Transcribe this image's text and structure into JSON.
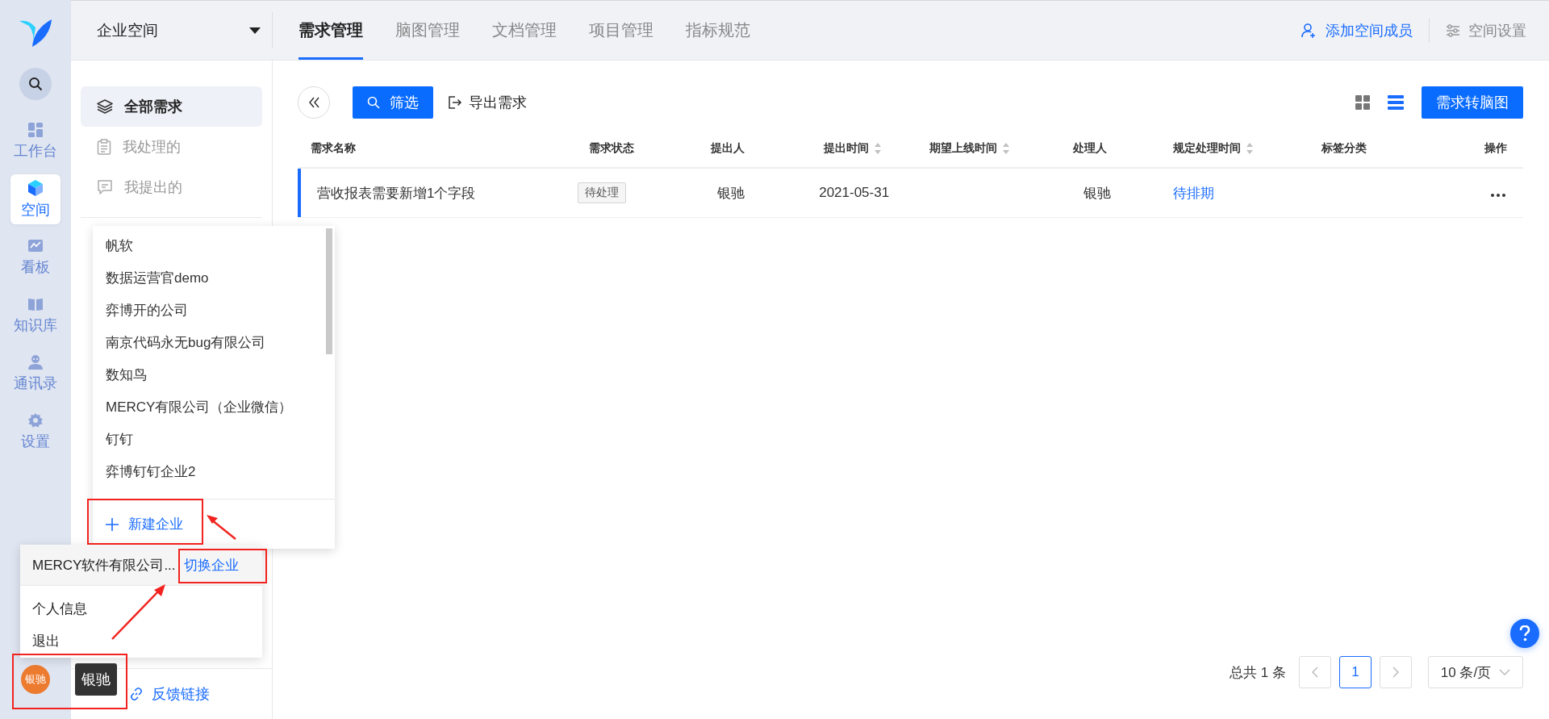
{
  "rail": {
    "items": [
      {
        "kind": "dashboard",
        "label": "工作台",
        "selected": false
      },
      {
        "kind": "cube",
        "label": "空间",
        "selected": true
      },
      {
        "kind": "board",
        "label": "看板",
        "selected": false
      },
      {
        "kind": "book",
        "label": "知识库",
        "selected": false
      },
      {
        "kind": "contacts",
        "label": "通讯录",
        "selected": false
      },
      {
        "kind": "settings",
        "label": "设置",
        "selected": false
      }
    ]
  },
  "space_selector": {
    "label": "企业空间"
  },
  "tabs": [
    {
      "label": "需求管理",
      "selected": true
    },
    {
      "label": "脑图管理",
      "selected": false
    },
    {
      "label": "文档管理",
      "selected": false
    },
    {
      "label": "项目管理",
      "selected": false
    },
    {
      "label": "指标规范",
      "selected": false
    }
  ],
  "header_actions": [
    {
      "kind": "add-member",
      "label": "添加空间成员"
    },
    {
      "kind": "settings",
      "label": "空间设置"
    }
  ],
  "nav": {
    "items": [
      {
        "kind": "layers",
        "label": "全部需求",
        "selected": true
      },
      {
        "kind": "clipboard",
        "label": "我处理的",
        "selected": false
      },
      {
        "kind": "comment",
        "label": "我提出的",
        "selected": false
      }
    ],
    "feedback_link": "反馈链接"
  },
  "toolbar": {
    "filter": "筛选",
    "export": "导出需求",
    "convert": "需求转脑图",
    "view_modes": [
      {
        "kind": "grid",
        "selected": false
      },
      {
        "kind": "list",
        "selected": true
      }
    ]
  },
  "table": {
    "columns": [
      {
        "label": "需求名称",
        "sortable": false
      },
      {
        "label": "需求状态",
        "sortable": false
      },
      {
        "label": "提出人",
        "sortable": false
      },
      {
        "label": "提出时间",
        "sortable": true
      },
      {
        "label": "期望上线时间",
        "sortable": true
      },
      {
        "label": "处理人",
        "sortable": false
      },
      {
        "label": "规定处理时间",
        "sortable": true
      },
      {
        "label": "标签分类",
        "sortable": false
      },
      {
        "label": "操作",
        "sortable": false
      }
    ],
    "rows": [
      {
        "selected": true,
        "name": "营收报表需要新增1个字段",
        "status": "待处理",
        "proposer": "银驰",
        "submitted": "2021-05-31",
        "handler": "银驰",
        "deadline": "待排期"
      }
    ]
  },
  "pagination": {
    "total": "总共 1 条",
    "pages": [
      {
        "label": "1",
        "selected": true
      }
    ],
    "page_size": "10 条/页"
  },
  "company_dropdown": {
    "items": [
      "帆软",
      "数据运营官demo",
      "弈博开的公司",
      "南京代码永无bug有限公司",
      "数知鸟",
      "MERCY有限公司（企业微信）",
      "钉钉",
      "弈博钉钉企业2"
    ],
    "new_button": "新建企业"
  },
  "user_menu": {
    "current_company": "MERCY软件有限公司...",
    "switch": "切换企业",
    "items": [
      "个人信息",
      "退出"
    ]
  },
  "user": {
    "avatar": "银驰",
    "tooltip": "银驰"
  }
}
